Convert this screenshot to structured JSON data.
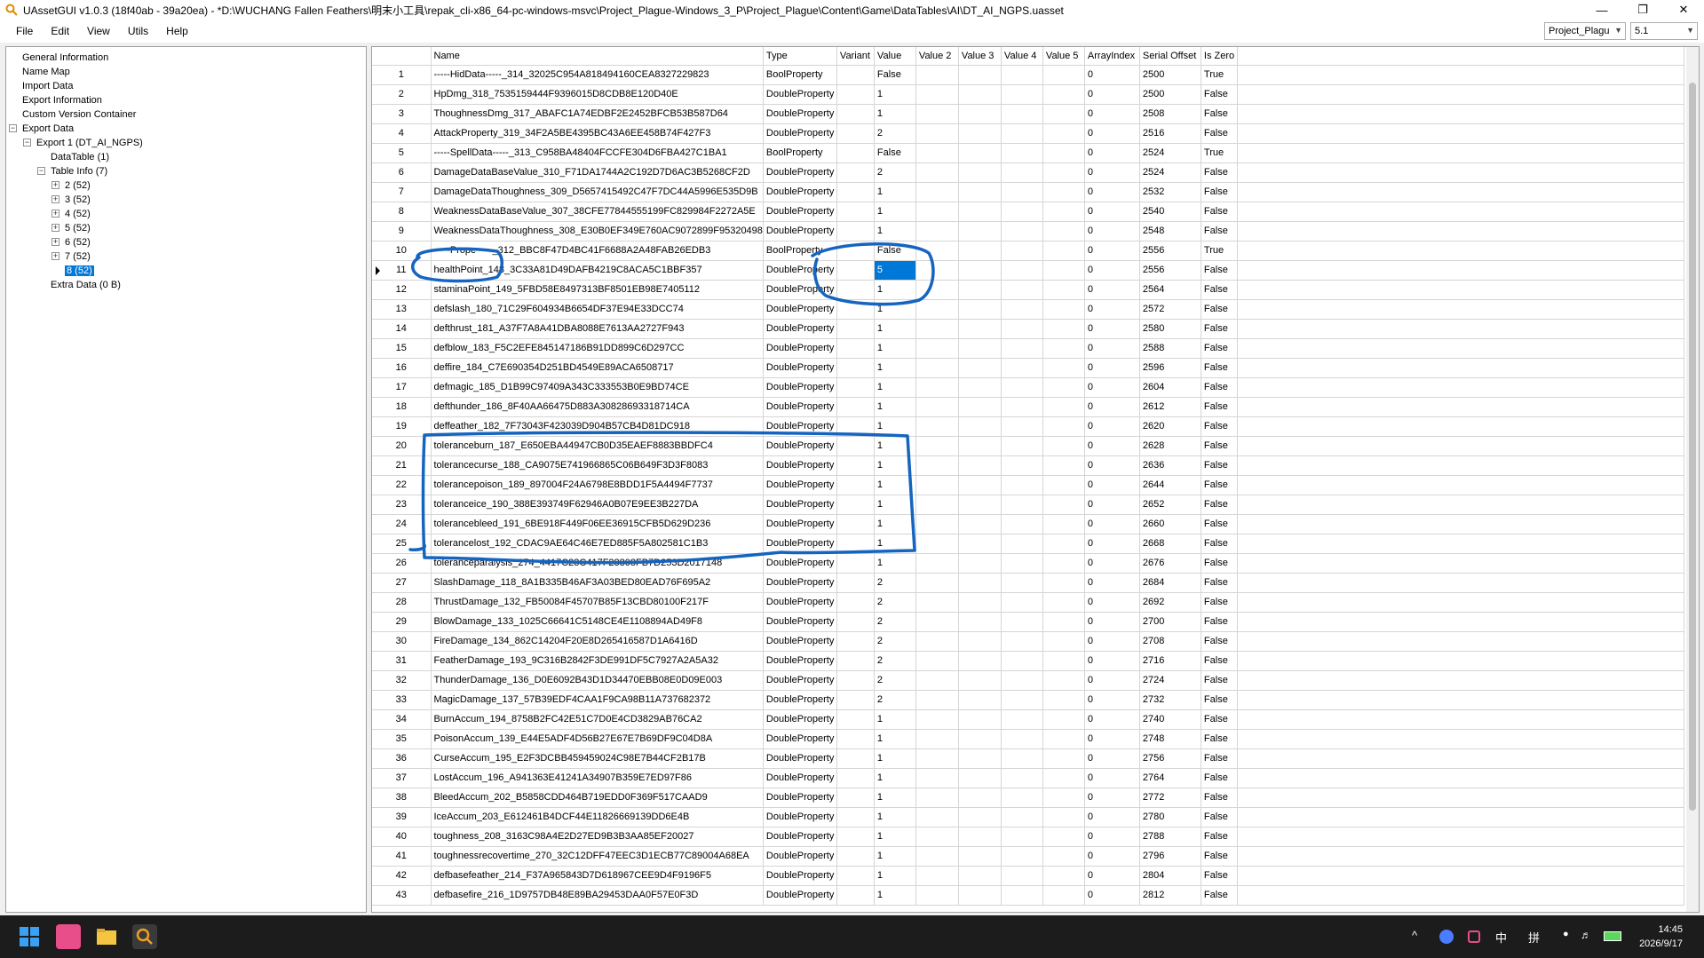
{
  "window": {
    "title": "UAssetGUI v1.0.3 (18f40ab - 39a20ea) - *D:\\WUCHANG Fallen Feathers\\明末小工具\\repak_cli-x86_64-pc-windows-msvc\\Project_Plague-Windows_3_P\\Project_Plague\\Content\\Game\\DataTables\\AI\\DT_AI_NGPS.uasset",
    "controls": [
      "minimize",
      "maximize",
      "close"
    ]
  },
  "menu": [
    "File",
    "Edit",
    "View",
    "Utils",
    "Help"
  ],
  "toolbar": {
    "project_combo": "Project_Plagu",
    "version_combo": "5.1"
  },
  "tree": [
    {
      "label": "General Information",
      "level": 0
    },
    {
      "label": "Name Map",
      "level": 0
    },
    {
      "label": "Import Data",
      "level": 0
    },
    {
      "label": "Export Information",
      "level": 0
    },
    {
      "label": "Custom Version Container",
      "level": 0
    },
    {
      "label": "Export Data",
      "level": 0,
      "expander": "minus"
    },
    {
      "label": "Export 1 (DT_AI_NGPS)",
      "level": 1,
      "expander": "minus"
    },
    {
      "label": "DataTable (1)",
      "level": 2
    },
    {
      "label": "Table Info (7)",
      "level": 2,
      "expander": "minus"
    },
    {
      "label": "2 (52)",
      "level": 3,
      "expander": "plus"
    },
    {
      "label": "3 (52)",
      "level": 3,
      "expander": "plus"
    },
    {
      "label": "4 (52)",
      "level": 3,
      "expander": "plus"
    },
    {
      "label": "5 (52)",
      "level": 3,
      "expander": "plus"
    },
    {
      "label": "6 (52)",
      "level": 3,
      "expander": "plus"
    },
    {
      "label": "7 (52)",
      "level": 3,
      "expander": "plus"
    },
    {
      "label": "8 (52)",
      "level": 3,
      "selected": true
    },
    {
      "label": "Extra Data (0 B)",
      "level": 2
    }
  ],
  "columns": [
    "Name",
    "Type",
    "Variant",
    "Value",
    "Value 2",
    "Value 3",
    "Value 4",
    "Value 5",
    "ArrayIndex",
    "Serial Offset",
    "Is Zero"
  ],
  "rows": [
    [
      "1",
      "-----HidData-----_314_32025C954A818494160CEA8327229823",
      "BoolProperty",
      "",
      "False",
      "",
      "",
      "",
      "",
      "0",
      "2500",
      "True"
    ],
    [
      "2",
      "HpDmg_318_7535159444F9396015D8CDB8E120D40E",
      "DoubleProperty",
      "",
      "1",
      "",
      "",
      "",
      "",
      "0",
      "2500",
      "False"
    ],
    [
      "3",
      "ThoughnessDmg_317_ABAFC1A74EDBF2E2452BFCB53B587D64",
      "DoubleProperty",
      "",
      "1",
      "",
      "",
      "",
      "",
      "0",
      "2508",
      "False"
    ],
    [
      "4",
      "AttackProperty_319_34F2A5BE4395BC43A6EE458B74F427F3",
      "DoubleProperty",
      "",
      "2",
      "",
      "",
      "",
      "",
      "0",
      "2516",
      "False"
    ],
    [
      "5",
      "-----SpellData-----_313_C958BA48404FCCFE304D6FBA427C1BA1",
      "BoolProperty",
      "",
      "False",
      "",
      "",
      "",
      "",
      "0",
      "2524",
      "True"
    ],
    [
      "6",
      "DamageDataBaseValue_310_F71DA1744A2C192D7D6AC3B5268CF2D",
      "DoubleProperty",
      "",
      "2",
      "",
      "",
      "",
      "",
      "0",
      "2524",
      "False"
    ],
    [
      "7",
      "DamageDataThoughness_309_D5657415492C47F7DC44A5996E535D9B",
      "DoubleProperty",
      "",
      "1",
      "",
      "",
      "",
      "",
      "0",
      "2532",
      "False"
    ],
    [
      "8",
      "WeaknessDataBaseValue_307_38CFE77844555199FC829984F2272A5E",
      "DoubleProperty",
      "",
      "1",
      "",
      "",
      "",
      "",
      "0",
      "2540",
      "False"
    ],
    [
      "9",
      "WeaknessDataThoughness_308_E30B0EF349E760AC9072899F95320498",
      "DoubleProperty",
      "",
      "1",
      "",
      "",
      "",
      "",
      "0",
      "2548",
      "False"
    ],
    [
      "10",
      "-----Prope-----_312_BBC8F47D4BC41F6688A2A48FAB26EDB3",
      "BoolProperty",
      "",
      "False",
      "",
      "",
      "",
      "",
      "0",
      "2556",
      "True"
    ],
    [
      "11",
      "healthPoint_148_3C33A81D49DAFB4219C8ACA5C1BBF357",
      "DoubleProperty",
      "",
      "5",
      "",
      "",
      "",
      "",
      "0",
      "2556",
      "False"
    ],
    [
      "12",
      "staminaPoint_149_5FBD58E8497313BF8501EB98E7405112",
      "DoubleProperty",
      "",
      "1",
      "",
      "",
      "",
      "",
      "0",
      "2564",
      "False"
    ],
    [
      "13",
      "defslash_180_71C29F604934B6654DF37E94E33DCC74",
      "DoubleProperty",
      "",
      "1",
      "",
      "",
      "",
      "",
      "0",
      "2572",
      "False"
    ],
    [
      "14",
      "defthrust_181_A37F7A8A41DBA8088E7613AA2727F943",
      "DoubleProperty",
      "",
      "1",
      "",
      "",
      "",
      "",
      "0",
      "2580",
      "False"
    ],
    [
      "15",
      "defblow_183_F5C2EFE845147186B91DD899C6D297CC",
      "DoubleProperty",
      "",
      "1",
      "",
      "",
      "",
      "",
      "0",
      "2588",
      "False"
    ],
    [
      "16",
      "deffire_184_C7E690354D251BD4549E89ACA6508717",
      "DoubleProperty",
      "",
      "1",
      "",
      "",
      "",
      "",
      "0",
      "2596",
      "False"
    ],
    [
      "17",
      "defmagic_185_D1B99C97409A343C333553B0E9BD74CE",
      "DoubleProperty",
      "",
      "1",
      "",
      "",
      "",
      "",
      "0",
      "2604",
      "False"
    ],
    [
      "18",
      "defthunder_186_8F40AA66475D883A30828693318714CA",
      "DoubleProperty",
      "",
      "1",
      "",
      "",
      "",
      "",
      "0",
      "2612",
      "False"
    ],
    [
      "19",
      "deffeather_182_7F73043F423039D904B57CB4D81DC918",
      "DoubleProperty",
      "",
      "1",
      "",
      "",
      "",
      "",
      "0",
      "2620",
      "False"
    ],
    [
      "20",
      "toleranceburn_187_E650EBA44947CB0D35EAEF8883BBDFC4",
      "DoubleProperty",
      "",
      "1",
      "",
      "",
      "",
      "",
      "0",
      "2628",
      "False"
    ],
    [
      "21",
      "tolerancecurse_188_CA9075E741966865C06B649F3D3F8083",
      "DoubleProperty",
      "",
      "1",
      "",
      "",
      "",
      "",
      "0",
      "2636",
      "False"
    ],
    [
      "22",
      "tolerancepoison_189_897004F24A6798E8BDD1F5A4494F7737",
      "DoubleProperty",
      "",
      "1",
      "",
      "",
      "",
      "",
      "0",
      "2644",
      "False"
    ],
    [
      "23",
      "toleranceice_190_388E393749F62946A0B07E9EE3B227DA",
      "DoubleProperty",
      "",
      "1",
      "",
      "",
      "",
      "",
      "0",
      "2652",
      "False"
    ],
    [
      "24",
      "tolerancebleed_191_6BE918F449F06EE36915CFB5D629D236",
      "DoubleProperty",
      "",
      "1",
      "",
      "",
      "",
      "",
      "0",
      "2660",
      "False"
    ],
    [
      "25",
      "tolerancelost_192_CDAC9AE64C46E7ED885F5A802581C1B3",
      "DoubleProperty",
      "",
      "1",
      "",
      "",
      "",
      "",
      "0",
      "2668",
      "False"
    ],
    [
      "26",
      "toleranceparalysis_274_4417C23C417F28808FB7D253D2017148",
      "DoubleProperty",
      "",
      "1",
      "",
      "",
      "",
      "",
      "0",
      "2676",
      "False"
    ],
    [
      "27",
      "SlashDamage_118_8A1B335B46AF3A03BED80EAD76F695A2",
      "DoubleProperty",
      "",
      "2",
      "",
      "",
      "",
      "",
      "0",
      "2684",
      "False"
    ],
    [
      "28",
      "ThrustDamage_132_FB50084F45707B85F13CBD80100F217F",
      "DoubleProperty",
      "",
      "2",
      "",
      "",
      "",
      "",
      "0",
      "2692",
      "False"
    ],
    [
      "29",
      "BlowDamage_133_1025C66641C5148CE4E1108894AD49F8",
      "DoubleProperty",
      "",
      "2",
      "",
      "",
      "",
      "",
      "0",
      "2700",
      "False"
    ],
    [
      "30",
      "FireDamage_134_862C14204F20E8D265416587D1A6416D",
      "DoubleProperty",
      "",
      "2",
      "",
      "",
      "",
      "",
      "0",
      "2708",
      "False"
    ],
    [
      "31",
      "FeatherDamage_193_9C316B2842F3DE991DF5C7927A2A5A32",
      "DoubleProperty",
      "",
      "2",
      "",
      "",
      "",
      "",
      "0",
      "2716",
      "False"
    ],
    [
      "32",
      "ThunderDamage_136_D0E6092B43D1D34470EBB08E0D09E003",
      "DoubleProperty",
      "",
      "2",
      "",
      "",
      "",
      "",
      "0",
      "2724",
      "False"
    ],
    [
      "33",
      "MagicDamage_137_57B39EDF4CAA1F9CA98B11A737682372",
      "DoubleProperty",
      "",
      "2",
      "",
      "",
      "",
      "",
      "0",
      "2732",
      "False"
    ],
    [
      "34",
      "BurnAccum_194_8758B2FC42E51C7D0E4CD3829AB76CA2",
      "DoubleProperty",
      "",
      "1",
      "",
      "",
      "",
      "",
      "0",
      "2740",
      "False"
    ],
    [
      "35",
      "PoisonAccum_139_E44E5ADF4D56B27E67E7B69DF9C04D8A",
      "DoubleProperty",
      "",
      "1",
      "",
      "",
      "",
      "",
      "0",
      "2748",
      "False"
    ],
    [
      "36",
      "CurseAccum_195_E2F3DCBB459459024C98E7B44CF2B17B",
      "DoubleProperty",
      "",
      "1",
      "",
      "",
      "",
      "",
      "0",
      "2756",
      "False"
    ],
    [
      "37",
      "LostAccum_196_A941363E41241A34907B359E7ED97F86",
      "DoubleProperty",
      "",
      "1",
      "",
      "",
      "",
      "",
      "0",
      "2764",
      "False"
    ],
    [
      "38",
      "BleedAccum_202_B5858CDD464B719EDD0F369F517CAAD9",
      "DoubleProperty",
      "",
      "1",
      "",
      "",
      "",
      "",
      "0",
      "2772",
      "False"
    ],
    [
      "39",
      "IceAccum_203_E612461B4DCF44E11826669139DD6E4B",
      "DoubleProperty",
      "",
      "1",
      "",
      "",
      "",
      "",
      "0",
      "2780",
      "False"
    ],
    [
      "40",
      "toughness_208_3163C98A4E2D27ED9B3B3AA85EF20027",
      "DoubleProperty",
      "",
      "1",
      "",
      "",
      "",
      "",
      "0",
      "2788",
      "False"
    ],
    [
      "41",
      "toughnessrecovertime_270_32C12DFF47EEC3D1ECB77C89004A68EA",
      "DoubleProperty",
      "",
      "1",
      "",
      "",
      "",
      "",
      "0",
      "2796",
      "False"
    ],
    [
      "42",
      "defbasefeather_214_F37A965843D7D618967CEE9D4F9196F5",
      "DoubleProperty",
      "",
      "1",
      "",
      "",
      "",
      "",
      "0",
      "2804",
      "False"
    ],
    [
      "43",
      "defbasefire_216_1D9757DB48E89BA29453DAA0F57E0F3D",
      "DoubleProperty",
      "",
      "1",
      "",
      "",
      "",
      "",
      "0",
      "2812",
      "False"
    ]
  ],
  "selected_row": "11",
  "taskbar": {
    "apps": [
      "windows-start",
      "meitu-app",
      "file-explorer",
      "search-app"
    ],
    "tray": [
      "^",
      "中",
      "拼"
    ],
    "time": "14:45",
    "date": "2026/9/17"
  },
  "colors": {
    "selection": "#0078d7",
    "annotation": "#1565c0",
    "taskbar": "#1c1c1c"
  }
}
